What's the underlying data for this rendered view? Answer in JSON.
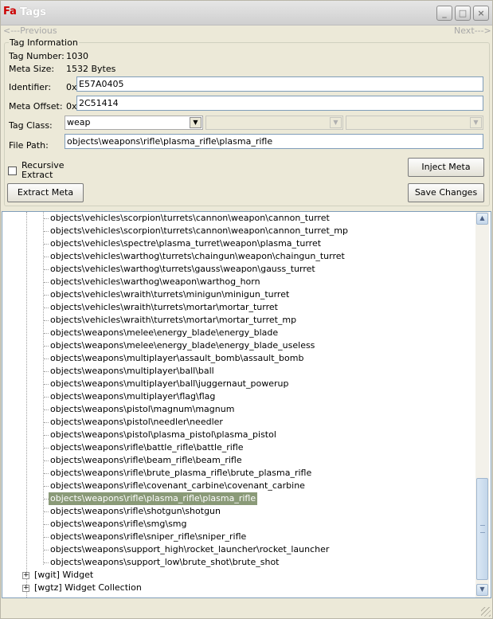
{
  "window": {
    "title": "Tags",
    "app_icon": "Fa"
  },
  "titlebar_buttons": {
    "minimize": "_",
    "maximize": "□",
    "close": "×"
  },
  "nav": {
    "previous": "<---Previous",
    "next": "Next--->"
  },
  "tag_info": {
    "legend": "Tag Information",
    "tag_number_label": "Tag Number:",
    "tag_number": "1030",
    "meta_size_label": "Meta Size:",
    "meta_size": "1532 Bytes",
    "identifier_label": "Identifier:",
    "identifier_prefix": "0x",
    "identifier": "E57A0405",
    "meta_offset_label": "Meta Offset:",
    "meta_offset_prefix": "0x",
    "meta_offset": "2C51414",
    "tag_class_label": "Tag Class:",
    "tag_class": "weap",
    "file_path_label": "File Path:",
    "file_path": "objects\\weapons\\rifle\\plasma_rifle\\plasma_rifle",
    "recursive_extract_label": "Recursive Extract",
    "recursive_extract_checked": false
  },
  "buttons": {
    "inject_meta": "Inject Meta",
    "extract_meta": "Extract Meta",
    "save_changes": "Save Changes"
  },
  "tree": {
    "items": [
      "objects\\vehicles\\scorpion\\turrets\\cannon\\weapon\\cannon_turret",
      "objects\\vehicles\\scorpion\\turrets\\cannon\\weapon\\cannon_turret_mp",
      "objects\\vehicles\\spectre\\plasma_turret\\weapon\\plasma_turret",
      "objects\\vehicles\\warthog\\turrets\\chaingun\\weapon\\chaingun_turret",
      "objects\\vehicles\\warthog\\turrets\\gauss\\weapon\\gauss_turret",
      "objects\\vehicles\\warthog\\weapon\\warthog_horn",
      "objects\\vehicles\\wraith\\turrets\\minigun\\minigun_turret",
      "objects\\vehicles\\wraith\\turrets\\mortar\\mortar_turret",
      "objects\\vehicles\\wraith\\turrets\\mortar\\mortar_turret_mp",
      "objects\\weapons\\melee\\energy_blade\\energy_blade",
      "objects\\weapons\\melee\\energy_blade\\energy_blade_useless",
      "objects\\weapons\\multiplayer\\assault_bomb\\assault_bomb",
      "objects\\weapons\\multiplayer\\ball\\ball",
      "objects\\weapons\\multiplayer\\ball\\juggernaut_powerup",
      "objects\\weapons\\multiplayer\\flag\\flag",
      "objects\\weapons\\pistol\\magnum\\magnum",
      "objects\\weapons\\pistol\\needler\\needler",
      "objects\\weapons\\pistol\\plasma_pistol\\plasma_pistol",
      "objects\\weapons\\rifle\\battle_rifle\\battle_rifle",
      "objects\\weapons\\rifle\\beam_rifle\\beam_rifle",
      "objects\\weapons\\rifle\\brute_plasma_rifle\\brute_plasma_rifle",
      "objects\\weapons\\rifle\\covenant_carbine\\covenant_carbine",
      "objects\\weapons\\rifle\\plasma_rifle\\plasma_rifle",
      "objects\\weapons\\rifle\\shotgun\\shotgun",
      "objects\\weapons\\rifle\\smg\\smg",
      "objects\\weapons\\rifle\\sniper_rifle\\sniper_rifle",
      "objects\\weapons\\support_high\\rocket_launcher\\rocket_launcher",
      "objects\\weapons\\support_low\\brute_shot\\brute_shot"
    ],
    "selected_index": 22,
    "nodes": [
      {
        "expander": "+",
        "label": "[wgit] Widget"
      },
      {
        "expander": "+",
        "label": "[wgtz] Widget Collection"
      }
    ],
    "selection_color": "#8a9a78"
  },
  "icons": {
    "scroll_up": "scroll-up-arrow-icon",
    "scroll_down": "scroll-down-arrow-icon",
    "dropdown": "chevron-down-icon"
  },
  "glyphs": {
    "up": "▲",
    "down": "▼"
  }
}
